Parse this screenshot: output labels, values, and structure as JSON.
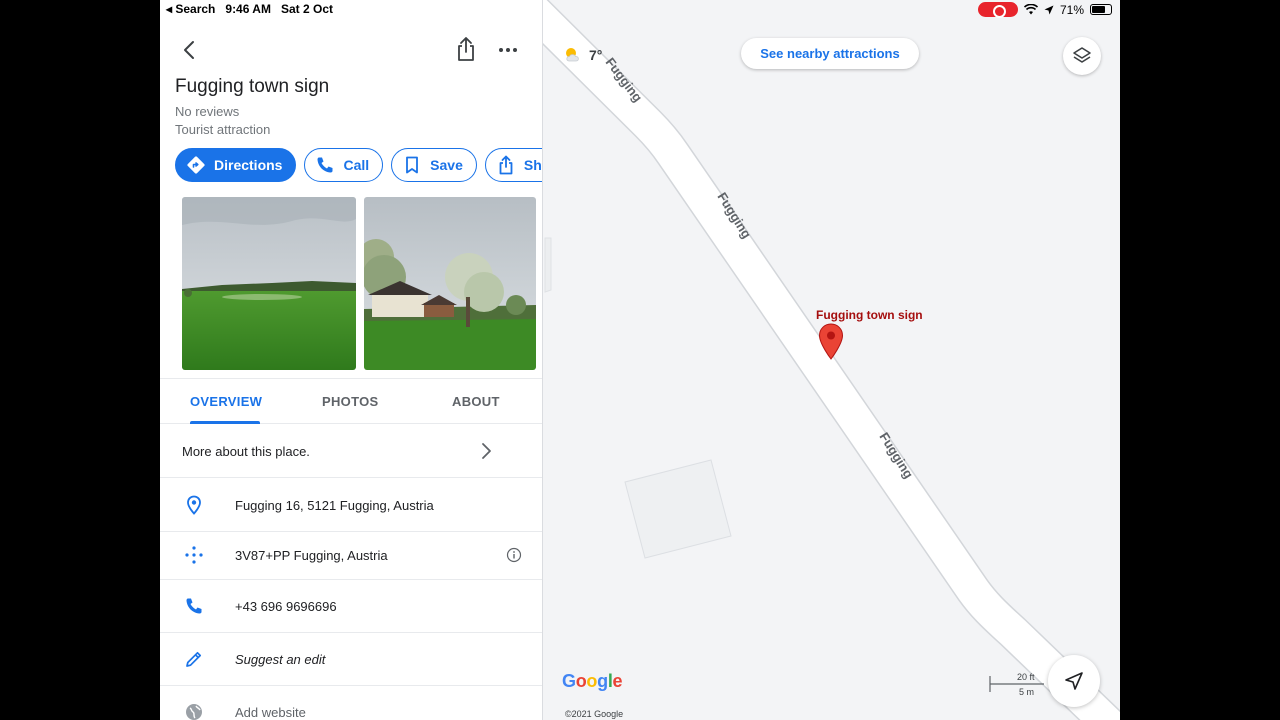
{
  "status_bar": {
    "back_app": "◂ Search",
    "time": "9:46 AM",
    "date": "Sat 2 Oct",
    "battery": "71%",
    "battery_level": 0.71
  },
  "place": {
    "title": "Fugging town sign",
    "reviews": "No reviews",
    "category": "Tourist attraction"
  },
  "actions": {
    "directions": "Directions",
    "call": "Call",
    "save": "Save",
    "share": "Share"
  },
  "tabs": {
    "overview": "OVERVIEW",
    "photos": "PHOTOS",
    "about": "ABOUT"
  },
  "details": {
    "more_about": "More about this place.",
    "address": "Fugging 16, 5121 Fugging, Austria",
    "plus_code": "3V87+PP Fugging, Austria",
    "phone": "+43 696 9696696",
    "suggest_edit": "Suggest an edit",
    "add_website": "Add website"
  },
  "map": {
    "weather_temp": "7°",
    "nearby_button": "See nearby attractions",
    "road_name": "Fugging",
    "pin_label": "Fugging town sign",
    "logo": "Google",
    "copyright": "©2021 Google",
    "scale_ft": "20 ft",
    "scale_m": "5 m"
  },
  "colors": {
    "accent": "#1a73e8",
    "pin": "#ea4335",
    "pin_label": "#a50e0e"
  }
}
